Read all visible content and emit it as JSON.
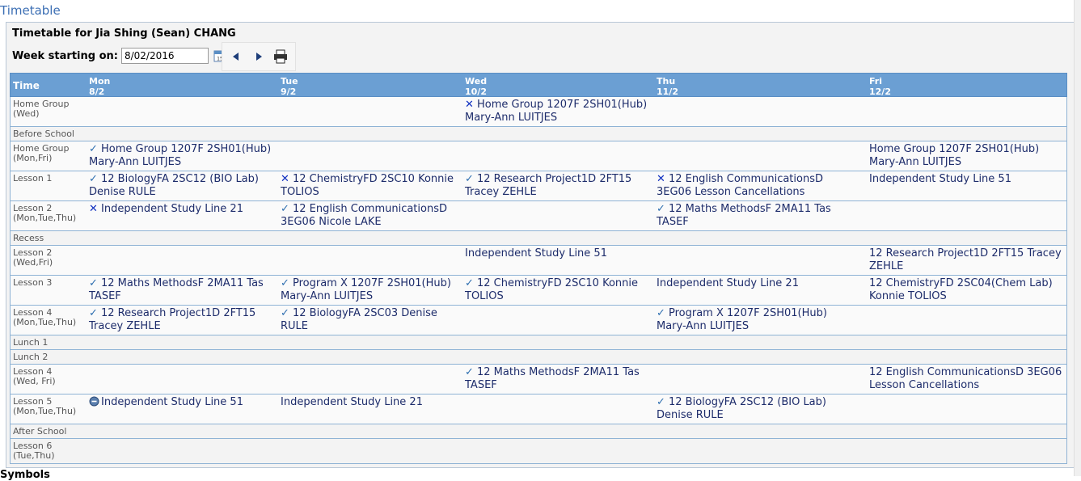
{
  "page_title": "Timetable",
  "panel_title": "Timetable for Jia Shing (Sean) CHANG",
  "week": {
    "label": "Week starting on:",
    "value": "8/02/2016"
  },
  "toolbar": {
    "calendar_icon": "calendar-icon",
    "prev_icon": "arrow-left-icon",
    "next_icon": "arrow-right-icon",
    "print_icon": "printer-icon"
  },
  "header": {
    "time_label": "Time",
    "days": [
      {
        "name": "Mon",
        "date": "8/2"
      },
      {
        "name": "Tue",
        "date": "9/2"
      },
      {
        "name": "Wed",
        "date": "10/2"
      },
      {
        "name": "Thu",
        "date": "11/2"
      },
      {
        "name": "Fri",
        "date": "12/2"
      }
    ]
  },
  "rows": [
    {
      "period": [
        "Home Group",
        "(Wed)"
      ],
      "cells": {
        "wed": {
          "icon": "cross",
          "text": "Home Group 1207F 2SH01(Hub) Mary-Ann LUITJES"
        }
      }
    },
    {
      "period": [
        "Before School"
      ],
      "cells": {}
    },
    {
      "period": [
        "Home Group",
        "(Mon,Fri)"
      ],
      "cells": {
        "mon": {
          "icon": "tick",
          "text": "Home Group 1207F 2SH01(Hub) Mary-Ann LUITJES"
        },
        "fri": {
          "icon": "",
          "text": "Home Group 1207F 2SH01(Hub) Mary-Ann LUITJES"
        }
      }
    },
    {
      "period": [
        "Lesson 1"
      ],
      "cells": {
        "mon": {
          "icon": "tick",
          "text": "12 BiologyFA 2SC12 (BIO Lab) Denise RULE"
        },
        "tue": {
          "icon": "cross",
          "text": "12 ChemistryFD 2SC10 Konnie TOLIOS"
        },
        "wed": {
          "icon": "tick",
          "text": "12 Research Project1D 2FT15 Tracey ZEHLE"
        },
        "thu": {
          "icon": "cross",
          "text": "12 English CommunicationsD 3EG06 Lesson Cancellations"
        },
        "fri": {
          "icon": "",
          "text": "Independent Study Line 51"
        }
      }
    },
    {
      "period": [
        "Lesson 2",
        "(Mon,Tue,Thu)"
      ],
      "cells": {
        "mon": {
          "icon": "cross",
          "text": "Independent Study Line 21"
        },
        "tue": {
          "icon": "tick",
          "text": "12 English CommunicationsD 3EG06 Nicole LAKE"
        },
        "thu": {
          "icon": "tick",
          "text": "12 Maths MethodsF 2MA11 Tas TASEF"
        }
      }
    },
    {
      "period": [
        "Recess"
      ],
      "cells": {}
    },
    {
      "period": [
        "Lesson 2",
        "(Wed,Fri)"
      ],
      "cells": {
        "wed": {
          "icon": "",
          "text": "Independent Study Line 51"
        },
        "fri": {
          "icon": "",
          "text": "12 Research Project1D 2FT15 Tracey ZEHLE"
        }
      }
    },
    {
      "period": [
        "Lesson 3"
      ],
      "cells": {
        "mon": {
          "icon": "tick",
          "text": "12 Maths MethodsF 2MA11 Tas TASEF"
        },
        "tue": {
          "icon": "tick",
          "text": "Program X 1207F 2SH01(Hub) Mary-Ann LUITJES"
        },
        "wed": {
          "icon": "tick",
          "text": "12 ChemistryFD 2SC10 Konnie TOLIOS"
        },
        "thu": {
          "icon": "",
          "text": "Independent Study Line 21"
        },
        "fri": {
          "icon": "",
          "text": "12 ChemistryFD 2SC04(Chem Lab) Konnie TOLIOS"
        }
      }
    },
    {
      "period": [
        "Lesson 4",
        "(Mon,Tue,Thu)"
      ],
      "cells": {
        "mon": {
          "icon": "tick",
          "text": "12 Research Project1D 2FT15 Tracey ZEHLE"
        },
        "tue": {
          "icon": "tick",
          "text": "12 BiologyFA 2SC03 Denise RULE"
        },
        "thu": {
          "icon": "tick",
          "text": "Program X 1207F 2SH01(Hub) Mary-Ann LUITJES"
        }
      }
    },
    {
      "period": [
        "Lunch 1"
      ],
      "cells": {}
    },
    {
      "period": [
        "Lunch 2"
      ],
      "cells": {}
    },
    {
      "period": [
        "Lesson 4",
        "(Wed, Fri)"
      ],
      "cells": {
        "wed": {
          "icon": "tick",
          "text": "12 Maths MethodsF 2MA11 Tas TASEF"
        },
        "fri": {
          "icon": "",
          "text": "12 English CommunicationsD 3EG06 Lesson Cancellations"
        }
      }
    },
    {
      "period": [
        "Lesson 5",
        "(Mon,Tue,Thu)"
      ],
      "cells": {
        "mon": {
          "icon": "circle",
          "text": "Independent Study Line 51"
        },
        "tue": {
          "icon": "",
          "text": "Independent Study Line 21"
        },
        "thu": {
          "icon": "tick",
          "text": "12 BiologyFA 2SC12 (BIO Lab) Denise RULE"
        }
      }
    },
    {
      "period": [
        "After School"
      ],
      "cells": {}
    },
    {
      "period": [
        "Lesson 6",
        "(Tue,Thu)"
      ],
      "cells": {}
    }
  ],
  "footer_label": "Symbols"
}
